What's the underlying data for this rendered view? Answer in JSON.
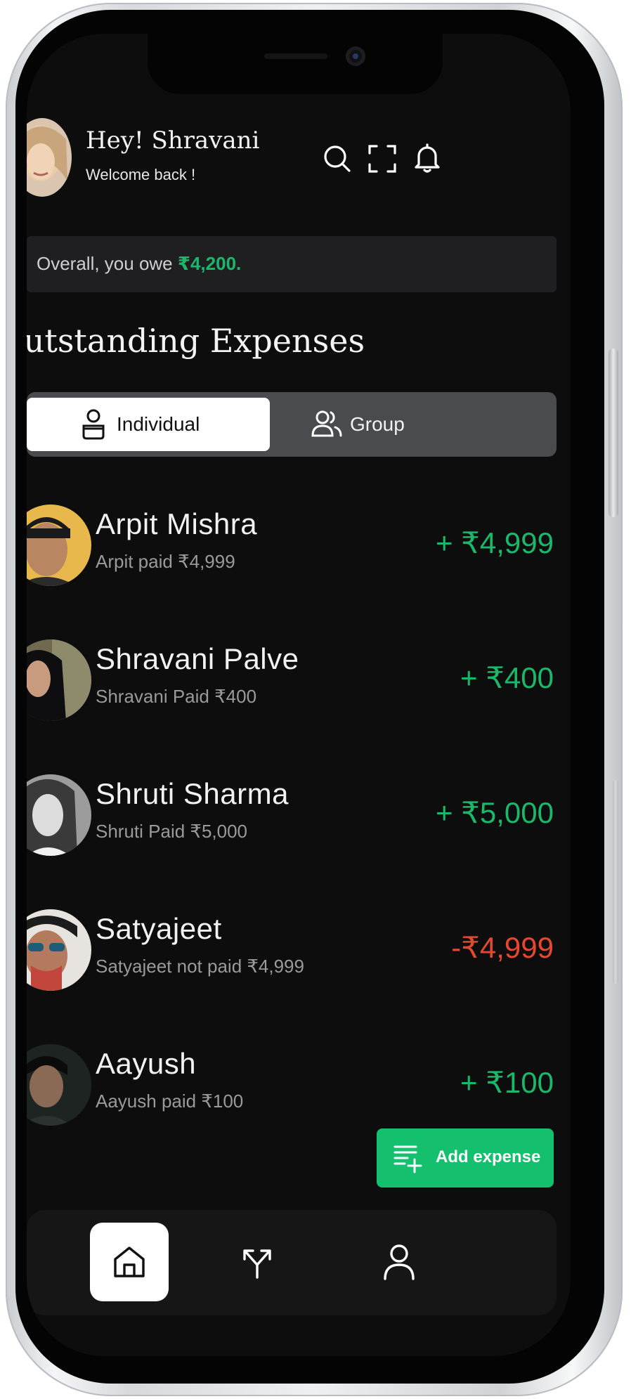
{
  "header": {
    "greeting": "Hey! Shravani",
    "subtitle": "Welcome back !"
  },
  "summary": {
    "prefix": "Overall, you owe ",
    "amount": "₹4,200."
  },
  "section": {
    "title": "Outstanding Expenses"
  },
  "tabs": [
    {
      "label": "Individual",
      "active": true
    },
    {
      "label": "Group",
      "active": false
    }
  ],
  "expenses": [
    {
      "name": "Arpit Mishra",
      "detail": "Arpit paid ₹4,999",
      "amount": "+ ₹4,999",
      "status": "positive"
    },
    {
      "name": "Shravani Palve",
      "detail": "Shravani Paid ₹400",
      "amount": "+ ₹400",
      "status": "positive"
    },
    {
      "name": "Shruti Sharma",
      "detail": "Shruti Paid ₹5,000",
      "amount": "+ ₹5,000",
      "status": "positive"
    },
    {
      "name": "Satyajeet",
      "detail": "Satyajeet not paid ₹4,999",
      "amount": "-₹4,999",
      "status": "negative"
    },
    {
      "name": "Aayush",
      "detail": "Aayush paid ₹100",
      "amount": "+ ₹100",
      "status": "positive"
    }
  ],
  "fab": {
    "label": "Add expense"
  },
  "nav": {
    "items": [
      {
        "icon": "home-icon",
        "active": true
      },
      {
        "icon": "split-icon",
        "active": false
      },
      {
        "icon": "profile-icon",
        "active": false
      }
    ]
  },
  "colors": {
    "positive": "#19b86a",
    "negative": "#e5482f",
    "accent": "#14bf6d",
    "background": "#0d0d0e"
  }
}
